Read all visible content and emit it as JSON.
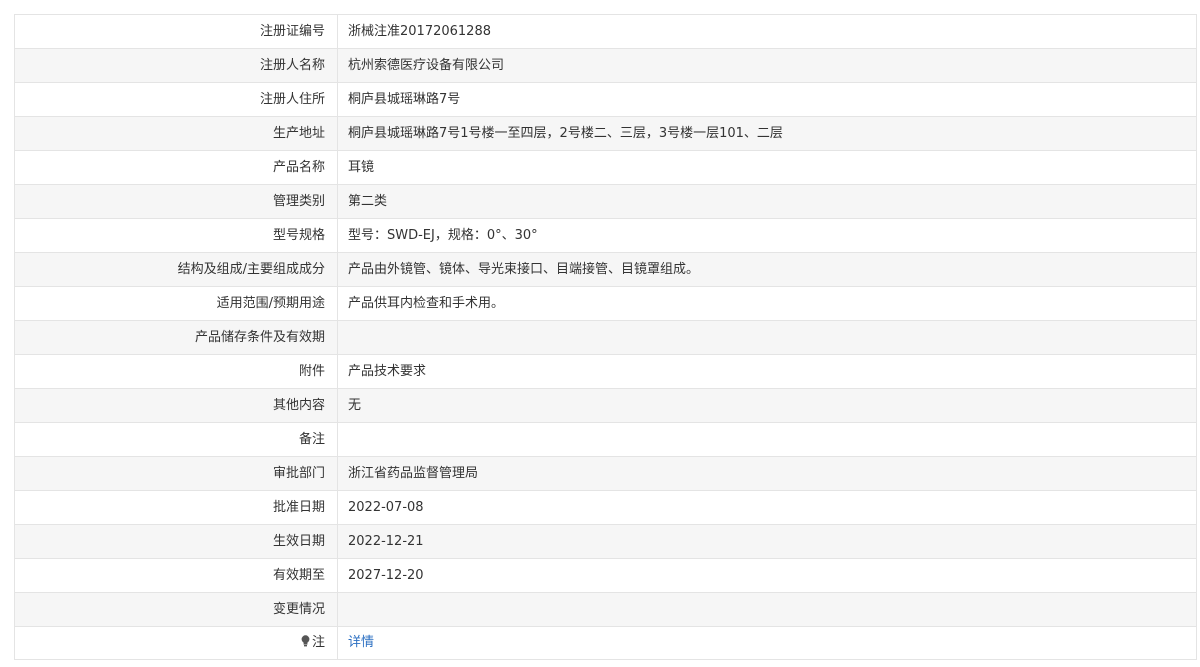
{
  "rows": [
    {
      "label": "注册证编号",
      "value": "浙械注准20172061288"
    },
    {
      "label": "注册人名称",
      "value": "杭州索德医疗设备有限公司"
    },
    {
      "label": "注册人住所",
      "value": "桐庐县城瑶琳路7号"
    },
    {
      "label": "生产地址",
      "value": "桐庐县城瑶琳路7号1号楼一至四层，2号楼二、三层，3号楼一层101、二层"
    },
    {
      "label": "产品名称",
      "value": "耳镜"
    },
    {
      "label": "管理类别",
      "value": "第二类"
    },
    {
      "label": "型号规格",
      "value": "型号：SWD-EJ，规格：0°、30°"
    },
    {
      "label": "结构及组成/主要组成成分",
      "value": "产品由外镜管、镜体、导光束接口、目端接管、目镜罩组成。"
    },
    {
      "label": "适用范围/预期用途",
      "value": "产品供耳内检查和手术用。"
    },
    {
      "label": "产品储存条件及有效期",
      "value": ""
    },
    {
      "label": "附件",
      "value": "产品技术要求"
    },
    {
      "label": "其他内容",
      "value": "无"
    },
    {
      "label": "备注",
      "value": ""
    },
    {
      "label": "审批部门",
      "value": "浙江省药品监督管理局"
    },
    {
      "label": "批准日期",
      "value": "2022-07-08"
    },
    {
      "label": "生效日期",
      "value": "2022-12-21"
    },
    {
      "label": "有效期至",
      "value": "2027-12-20"
    },
    {
      "label": "变更情况",
      "value": ""
    }
  ],
  "note_row": {
    "label": "注",
    "icon": "lightbulb-icon",
    "link_text": "详情"
  },
  "colors": {
    "border": "#e4e4e4",
    "stripe": "#f6f6f6",
    "text": "#333333",
    "link": "#2b6fc2"
  }
}
